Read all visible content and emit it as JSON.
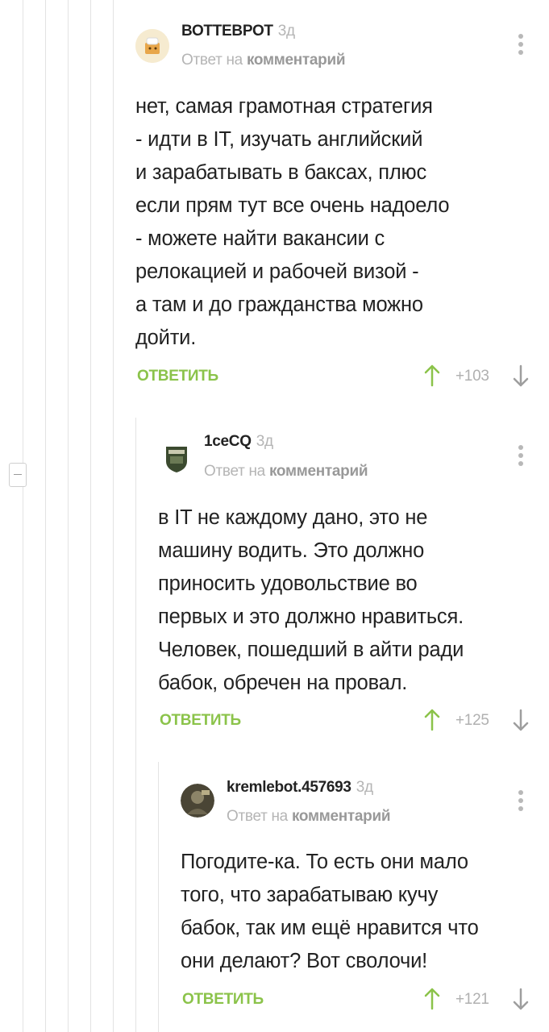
{
  "comments": [
    {
      "author": "ВОТТЕВРОТ",
      "age": "3д",
      "reply_prefix": "Ответ на",
      "reply_link": "комментарий",
      "lines": [
        "нет, самая грамотная стратегия",
        "- идти в IT, изучать английский",
        "и зарабатывать в баксах, плюс",
        "если прям тут все очень надоело",
        "- можете найти вакансии с",
        "релокацией и рабочей визой -",
        "а там и до гражданства можно",
        "дойти."
      ],
      "reply_label": "ОТВЕТИТЬ",
      "score": "+103"
    },
    {
      "author": "1ceCQ",
      "age": "3д",
      "reply_prefix": "Ответ на",
      "reply_link": "комментарий",
      "lines": [
        "в IT не каждому дано, это не",
        "машину водить. Это должно",
        "приносить удовольствие во",
        "первых и это должно нравиться.",
        "Человек, пошедший в айти ради",
        "бабок, обречен на провал."
      ],
      "reply_label": "ОТВЕТИТЬ",
      "score": "+125"
    },
    {
      "author": "kremlebot.457693",
      "age": "3д",
      "reply_prefix": "Ответ на",
      "reply_link": "комментарий",
      "lines": [
        "Погодите-ка. То есть они мало",
        "того, что зарабатываю кучу",
        "бабок, так им ещё нравится что",
        "они делают? Вот сволочи!"
      ],
      "reply_label": "ОТВЕТИТЬ",
      "score": "+121"
    }
  ],
  "icons": {
    "upvote": "arrow-up-icon",
    "downvote": "arrow-down-icon",
    "menu": "more-vertical-icon",
    "collapse": "minus-icon"
  },
  "colors": {
    "accent_green": "#8bc34a",
    "meta_gray": "#b5b5b5",
    "thread_line": "#e3e3e3"
  }
}
